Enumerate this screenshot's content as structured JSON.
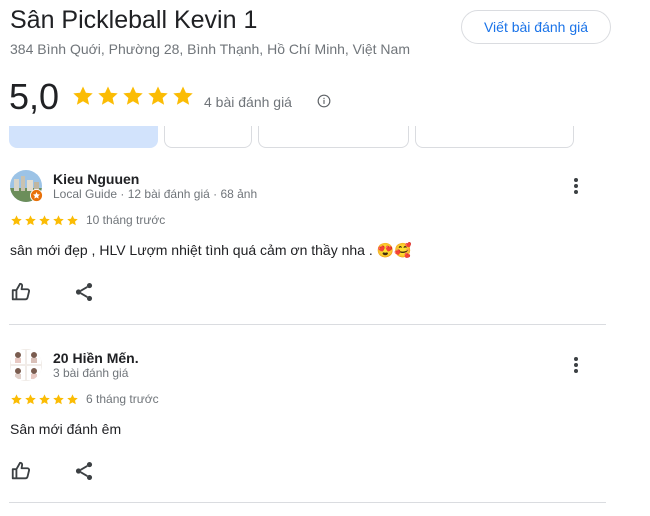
{
  "header": {
    "title": "Sân Pickleball Kevin 1",
    "address": "384 Bình Quới, Phường 28, Bình Thạnh, Hồ Chí Minh, Việt Nam",
    "write_review_label": "Viết bài đánh giá"
  },
  "summary": {
    "rating": "5,0",
    "stars": 5,
    "review_count": "4 bài đánh giá"
  },
  "colors": {
    "star": "#fbbc04",
    "accent": "#1a73e8",
    "active_chip": "#d2e3fc"
  },
  "reviews": [
    {
      "author": "Kieu Nguuen",
      "meta": "Local Guide · 12 bài đánh giá · 68 ảnh",
      "stars": 5,
      "when": "10 tháng trước",
      "text": "sân mới đẹp , HLV Lượm nhiệt tình quá cảm ơn thầy nha .",
      "emoji": "😍🥰"
    },
    {
      "author": "20 Hiền Mến.",
      "meta": "3 bài đánh giá",
      "stars": 5,
      "when": "6 tháng trước",
      "text": "Sân mới đánh êm",
      "emoji": ""
    }
  ]
}
